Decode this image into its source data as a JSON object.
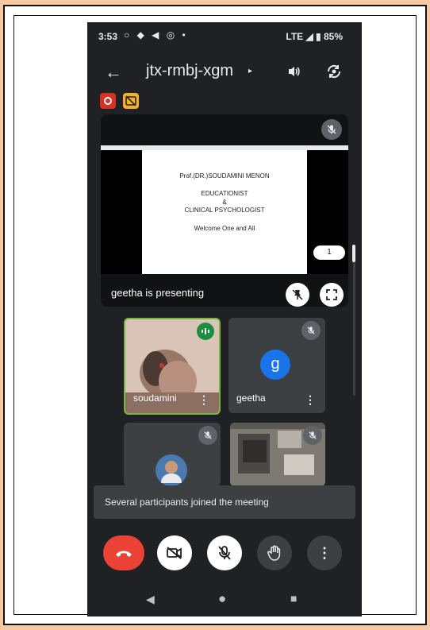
{
  "status_bar": {
    "time": "3:53",
    "left_icons": "○ ◆ ◀ ◎ •",
    "right": "LTE ◢ ▮ 85%"
  },
  "call": {
    "meeting_code": "jtx-rmbj-xgm",
    "chevron": "▸",
    "back_icon": "back-arrow-icon",
    "speaker_icon": "speaker-icon",
    "switch_camera_icon": "switch-camera-icon"
  },
  "badges": {
    "recording_color": "#d93025",
    "captions_color": "#f6b026"
  },
  "presentation": {
    "slide_lines": [
      "Prof.(DR.)SOUDAMINI MENON",
      "EDUCATIONIST",
      "&",
      "CLINICAL PSYCHOLOGIST",
      "Welcome One and All"
    ],
    "page_number": "1",
    "presenter_label": "geetha is presenting"
  },
  "participants": [
    {
      "name": "soudamini",
      "speaking": true
    },
    {
      "name": "geetha",
      "avatar_letter": "g",
      "avatar_color": "#1a73e8"
    },
    {
      "name": ""
    },
    {
      "name": ""
    }
  ],
  "toast": {
    "message": "Several participants joined the meeting"
  },
  "controls": {
    "end_call_color": "#ea4335",
    "items": [
      "end-call-icon",
      "camera-off-icon",
      "mic-off-icon",
      "raise-hand-icon",
      "more-options-icon"
    ]
  },
  "nav": {
    "back": "◀",
    "home": "●",
    "recents": "■"
  }
}
